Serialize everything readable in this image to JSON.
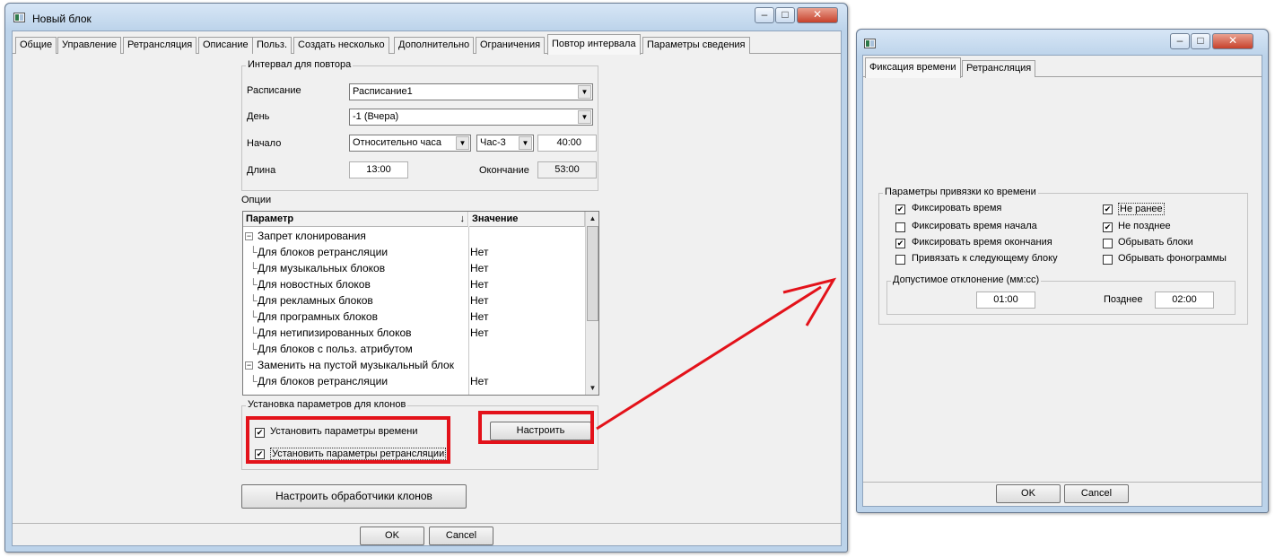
{
  "main_window": {
    "title": "Новый блок",
    "tabs": [
      "Общие",
      "Управление",
      "Ретрансляция",
      "Описание",
      "Польз.",
      "Создать несколько",
      "Дополнительно",
      "Ограничения",
      "Повтор интервала",
      "Параметры сведения"
    ],
    "active_tab": "Повтор интервала",
    "interval_group": {
      "title": "Интервал для повтора",
      "schedule_label": "Расписание",
      "schedule_value": "Расписание1",
      "day_label": "День",
      "day_value": "-1 (Вчера)",
      "start_label": "Начало",
      "start_mode": "Относительно часа",
      "start_hour": "Час-3",
      "start_time": "40:00",
      "length_label": "Длина",
      "length_value": "13:00",
      "end_label": "Окончание",
      "end_value": "53:00"
    },
    "options": {
      "title": "Опции",
      "col_param": "Параметр",
      "col_value": "Значение",
      "rows": [
        {
          "label": "Запрет клонирования",
          "value": "",
          "group": true
        },
        {
          "label": "Для блоков ретрансляции",
          "value": "Нет"
        },
        {
          "label": "Для музыкальных блоков",
          "value": "Нет"
        },
        {
          "label": "Для новостных блоков",
          "value": "Нет"
        },
        {
          "label": "Для рекламных блоков",
          "value": "Нет"
        },
        {
          "label": "Для програмных блоков",
          "value": "Нет"
        },
        {
          "label": "Для нетипизированных блоков",
          "value": "Нет"
        },
        {
          "label": "Для блоков с польз. атрибутом",
          "value": ""
        },
        {
          "label": "Заменить на пустой музыкальный блок",
          "value": "",
          "group": true
        },
        {
          "label": "Для блоков ретрансляции",
          "value": "Нет"
        }
      ]
    },
    "clone_group": {
      "title": "Установка параметров для клонов",
      "set_time": "Установить параметры времени",
      "set_retrans": "Установить параметры ретрансляции",
      "configure": "Настроить"
    },
    "handlers_button": "Настроить обработчики клонов",
    "ok": "OK",
    "cancel": "Cancel"
  },
  "second_window": {
    "tabs": [
      "Фиксация времени",
      "Ретрансляция"
    ],
    "active_tab": "Фиксация времени",
    "binding_group": {
      "title": "Параметры привязки ко времени",
      "left": [
        {
          "label": "Фиксировать время",
          "checked": true
        },
        {
          "label": "Фиксировать время начала",
          "checked": false
        },
        {
          "label": "Фиксировать время окончания",
          "checked": true
        },
        {
          "label": "Привязать к следующему блоку",
          "checked": false
        }
      ],
      "right": [
        {
          "label": "Не ранее",
          "checked": true
        },
        {
          "label": "Не позднее",
          "checked": true
        },
        {
          "label": "Обрывать блоки",
          "checked": false
        },
        {
          "label": "Обрывать фонограммы",
          "checked": false
        }
      ],
      "deviation": {
        "title": "Допустимое отклонение (мм:сс)",
        "early_value": "01:00",
        "late_label": "Позднее",
        "late_value": "02:00"
      }
    },
    "ok": "OK",
    "cancel": "Cancel"
  },
  "annotation": {
    "highlight_color": "#e3121a"
  }
}
